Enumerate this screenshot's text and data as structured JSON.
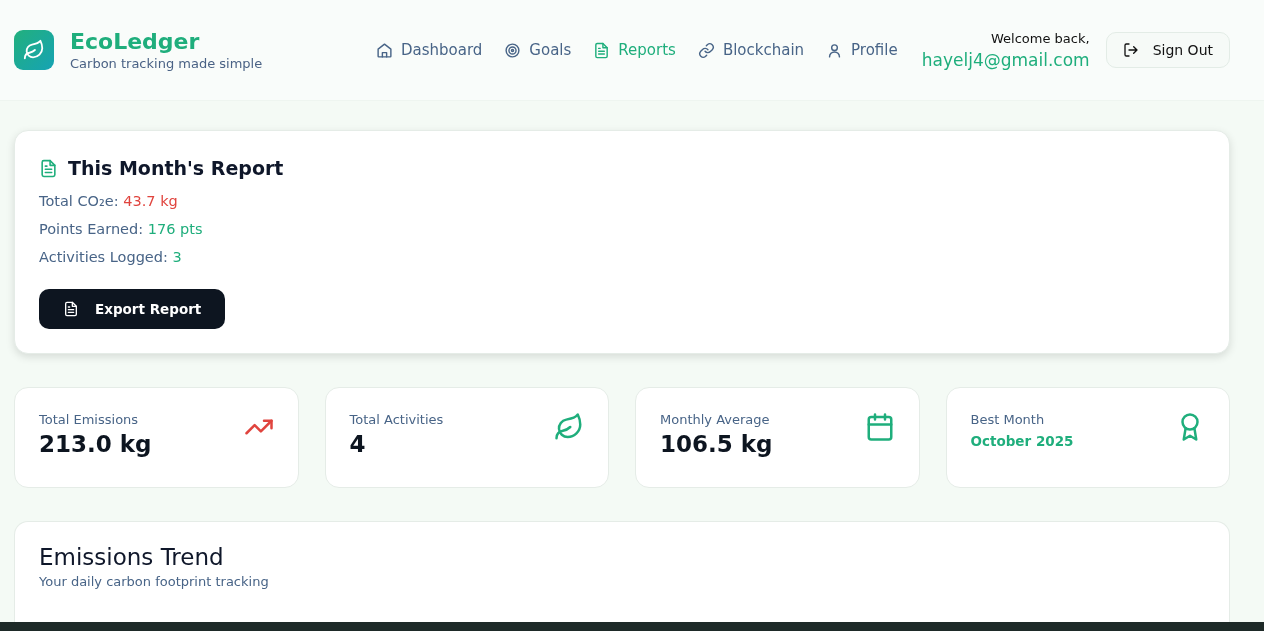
{
  "brand": {
    "name": "EcoLedger",
    "tagline": "Carbon tracking made simple"
  },
  "nav": [
    {
      "label": "Dashboard",
      "selected": false
    },
    {
      "label": "Goals",
      "selected": false
    },
    {
      "label": "Reports",
      "selected": true
    },
    {
      "label": "Blockchain",
      "selected": false
    },
    {
      "label": "Profile",
      "selected": false
    }
  ],
  "user": {
    "greeting": "Welcome back,",
    "email": "hayelj4@gmail.com"
  },
  "sign_out": "Sign Out",
  "report": {
    "title": "This Month's Report",
    "lines": [
      {
        "label": "Total CO₂e:",
        "value": "43.7 kg",
        "color": "#e0443e"
      },
      {
        "label": "Points Earned:",
        "value": "176 pts",
        "color": "#1fae7c"
      },
      {
        "label": "Activities Logged:",
        "value": "3",
        "color": "#1fae7c"
      }
    ],
    "export_button": "Export Report"
  },
  "stats": [
    {
      "label": "Total Emissions",
      "value": "213.0 kg",
      "kind": "number"
    },
    {
      "label": "Total Activities",
      "value": "4",
      "kind": "number"
    },
    {
      "label": "Monthly Average",
      "value": "106.5 kg",
      "kind": "number"
    },
    {
      "label": "Best Month",
      "value": "October 2025",
      "kind": "highlight"
    }
  ],
  "trend": {
    "title": "Emissions Trend",
    "subtitle": "Your daily carbon footprint tracking"
  }
}
